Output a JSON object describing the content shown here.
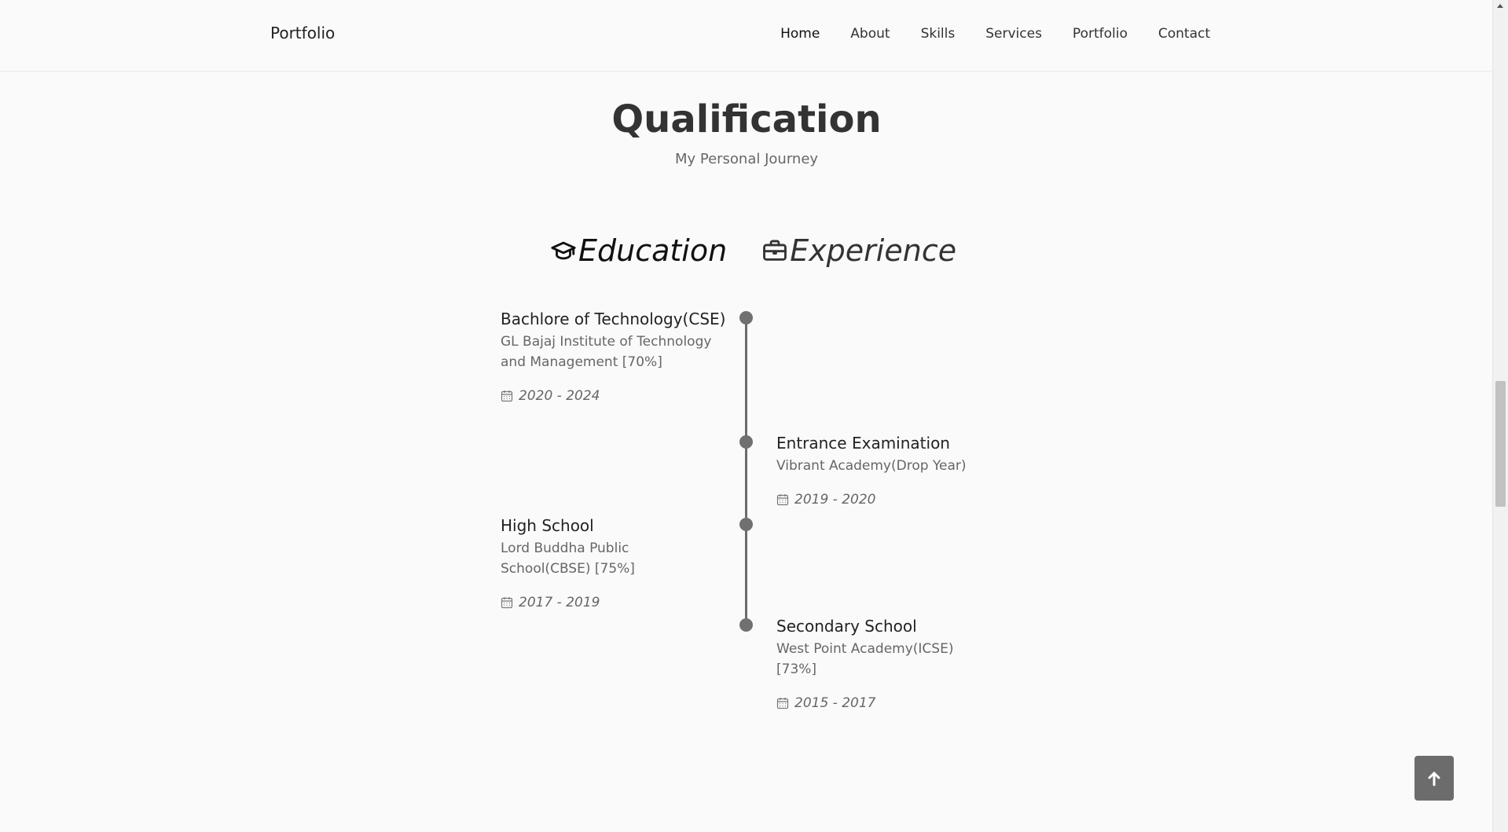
{
  "header": {
    "logo": "Portfolio",
    "nav": [
      "Home",
      "About",
      "Skills",
      "Services",
      "Portfolio",
      "Contact"
    ],
    "active": "Home"
  },
  "section": {
    "title": "Qualification",
    "subtitle": "My Personal Journey"
  },
  "tabs": {
    "education": {
      "label": "Education",
      "icon": "graduation-cap-icon"
    },
    "experience": {
      "label": "Experience",
      "icon": "briefcase-icon"
    }
  },
  "timeline": [
    {
      "title": "Bachlore of Technology(CSE)",
      "subtitle": "GL Bajaj Institute of Technology and Management [70%]",
      "date": "2020 - 2024",
      "side": "left"
    },
    {
      "title": "Entrance Examination",
      "subtitle": "Vibrant Academy(Drop Year)",
      "date": "2019 - 2020",
      "side": "right"
    },
    {
      "title": "High School",
      "subtitle": "Lord Buddha Public School(CBSE) [75%]",
      "date": "2017 - 2019",
      "side": "left"
    },
    {
      "title": "Secondary School",
      "subtitle": "West Point Academy(ICSE) [73%]",
      "date": "2015 - 2017",
      "side": "right"
    }
  ],
  "colors": {
    "background": "#fafafa",
    "timeline": "#6b6b6b",
    "scroll_button": "#6c6c6c"
  },
  "scroll_up_icon": "arrow-up-icon",
  "calendar_icon": "calendar-icon"
}
